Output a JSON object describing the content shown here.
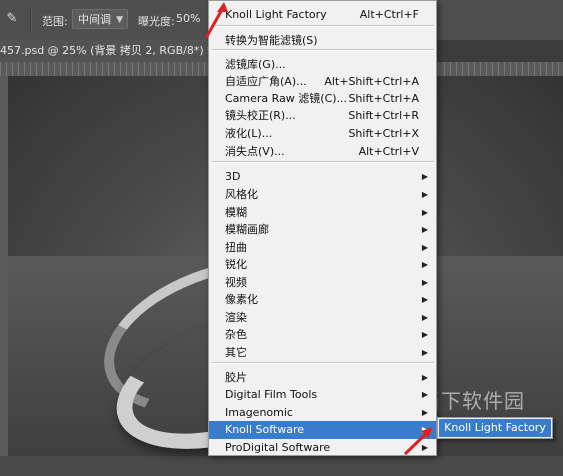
{
  "options_bar": {
    "range_label": "范围:",
    "range_value": "中间调",
    "exposure_label": "曝光度:",
    "exposure_value": "50%"
  },
  "document_tab": {
    "title": "457.psd @ 25% (背景 拷贝 2, RGB/8*) *"
  },
  "watermark": {
    "text": "当下软件园"
  },
  "filter_menu": {
    "items": [
      {
        "label": "Knoll Light Factory",
        "shortcut": "Alt+Ctrl+F",
        "submenu": false
      },
      {
        "label": "转换为智能滤镜(S)",
        "shortcut": "",
        "submenu": false
      },
      {
        "label": "滤镜库(G)...",
        "shortcut": "",
        "submenu": false
      },
      {
        "label": "自适应广角(A)...",
        "shortcut": "Alt+Shift+Ctrl+A",
        "submenu": false
      },
      {
        "label": "Camera Raw 滤镜(C)...",
        "shortcut": "Shift+Ctrl+A",
        "submenu": false
      },
      {
        "label": "镜头校正(R)...",
        "shortcut": "Shift+Ctrl+R",
        "submenu": false
      },
      {
        "label": "液化(L)...",
        "shortcut": "Shift+Ctrl+X",
        "submenu": false
      },
      {
        "label": "消失点(V)...",
        "shortcut": "Alt+Ctrl+V",
        "submenu": false
      },
      {
        "label": "3D",
        "shortcut": "",
        "submenu": true
      },
      {
        "label": "风格化",
        "shortcut": "",
        "submenu": true
      },
      {
        "label": "模糊",
        "shortcut": "",
        "submenu": true
      },
      {
        "label": "模糊画廊",
        "shortcut": "",
        "submenu": true
      },
      {
        "label": "扭曲",
        "shortcut": "",
        "submenu": true
      },
      {
        "label": "锐化",
        "shortcut": "",
        "submenu": true
      },
      {
        "label": "视频",
        "shortcut": "",
        "submenu": true
      },
      {
        "label": "像素化",
        "shortcut": "",
        "submenu": true
      },
      {
        "label": "渲染",
        "shortcut": "",
        "submenu": true
      },
      {
        "label": "杂色",
        "shortcut": "",
        "submenu": true
      },
      {
        "label": "其它",
        "shortcut": "",
        "submenu": true
      },
      {
        "label": "胶片",
        "shortcut": "",
        "submenu": true
      },
      {
        "label": "Digital Film Tools",
        "shortcut": "",
        "submenu": true
      },
      {
        "label": "Imagenomic",
        "shortcut": "",
        "submenu": true
      },
      {
        "label": "Knoll Software",
        "shortcut": "",
        "submenu": true,
        "highlighted": true
      },
      {
        "label": "ProDigital Software",
        "shortcut": "",
        "submenu": true
      }
    ]
  },
  "submenu": {
    "item": "Knoll Light Factory"
  },
  "colors": {
    "highlight": "#3a7ccc",
    "menu_bg": "#f1f1f1",
    "annotation": "#e02020"
  }
}
